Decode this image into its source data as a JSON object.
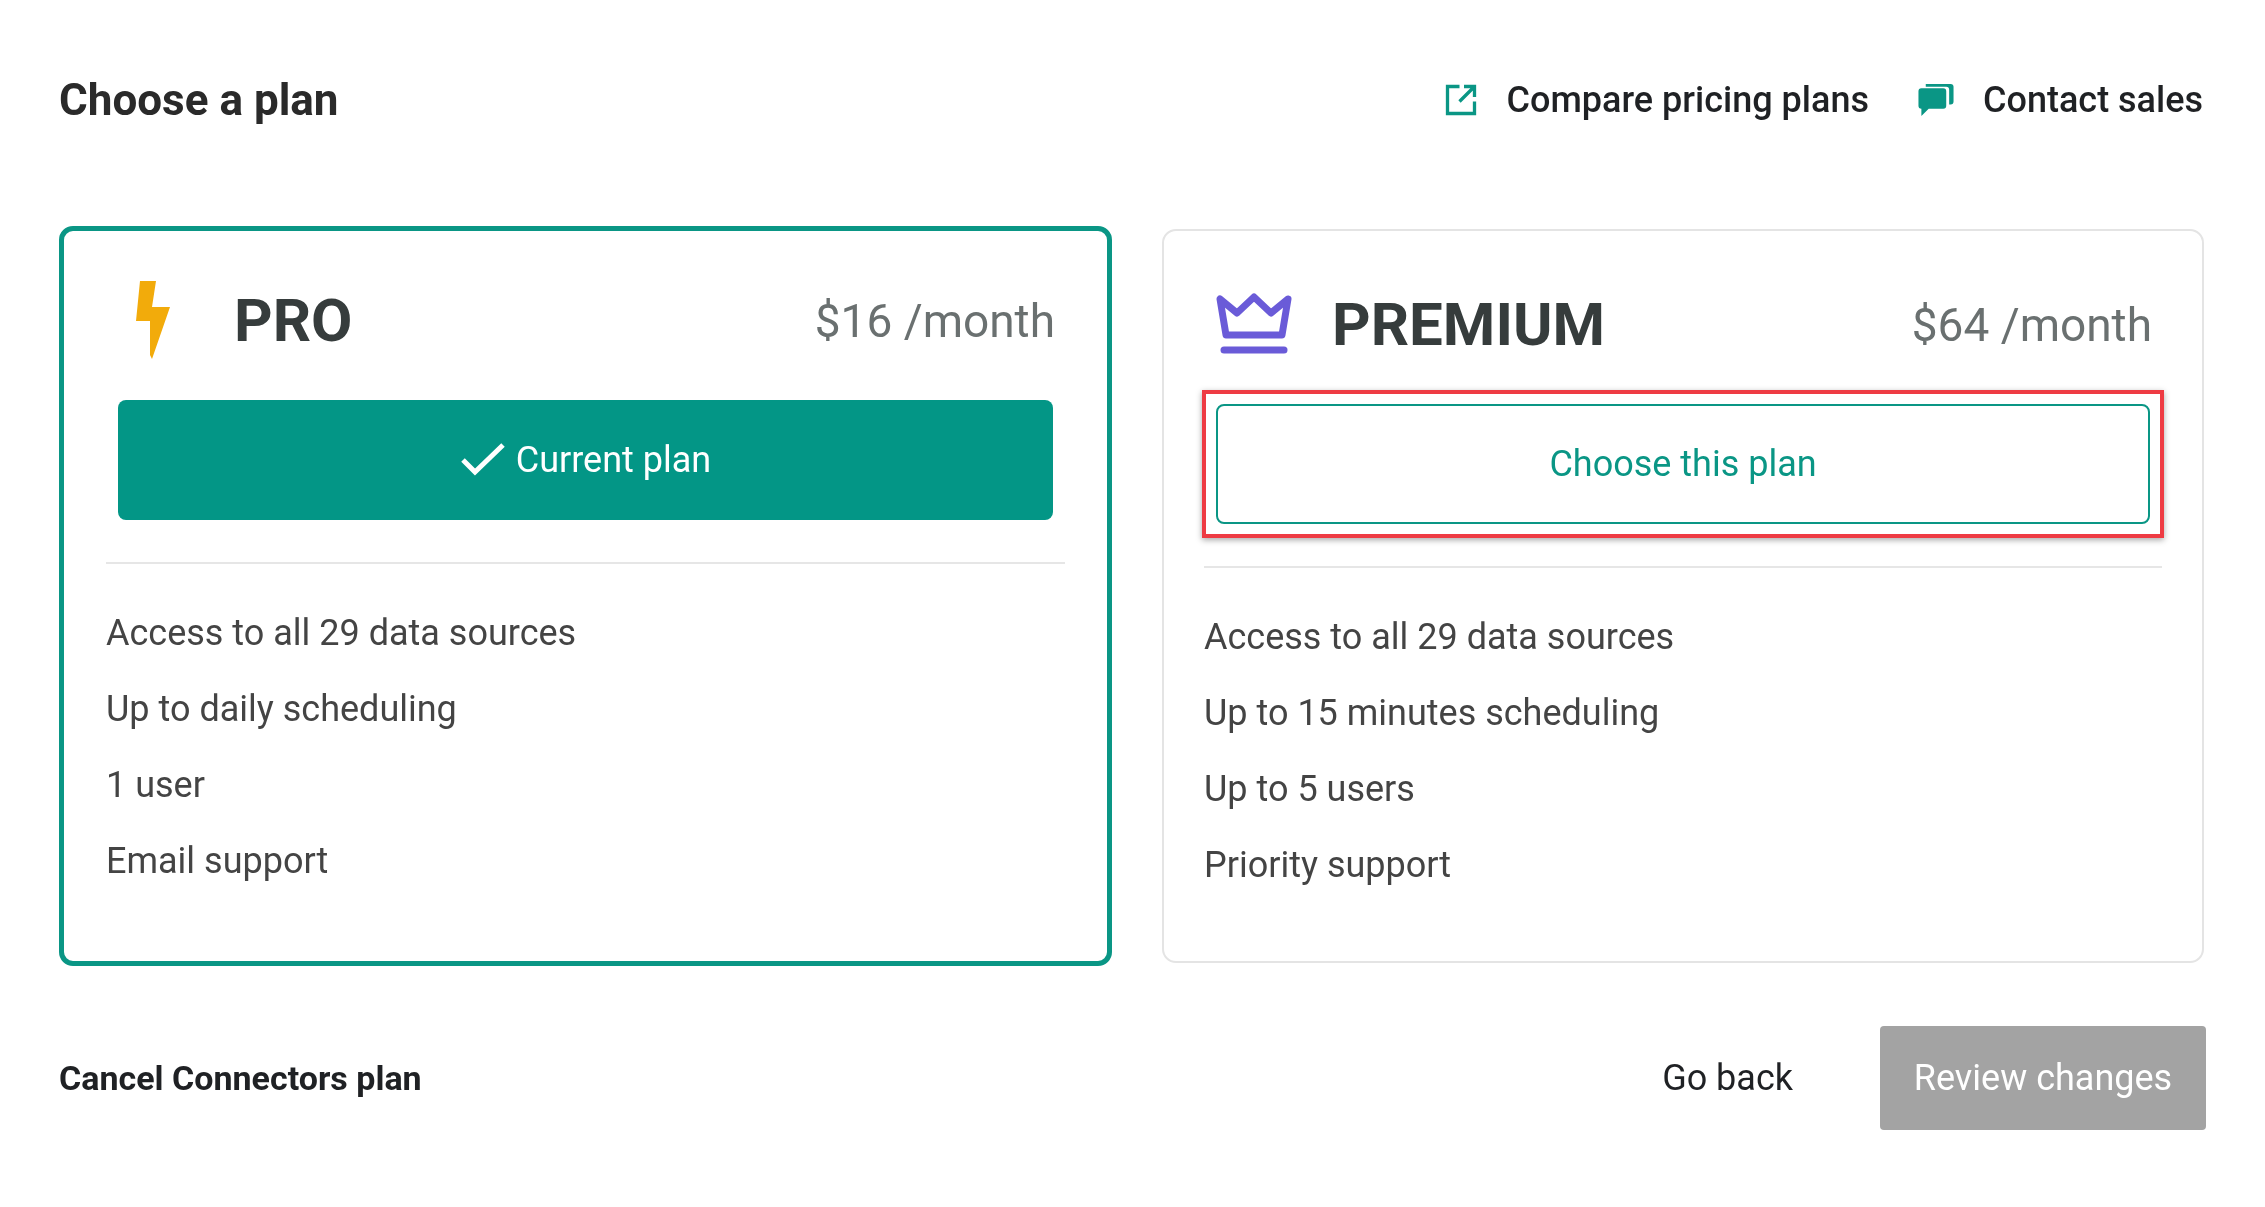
{
  "header": {
    "title": "Choose a plan",
    "links": [
      {
        "kind": "external",
        "label": "Compare pricing plans"
      },
      {
        "kind": "chat",
        "label": "Contact sales"
      }
    ]
  },
  "plans": [
    {
      "kind": "bolt",
      "name": "PRO",
      "price": "$16 /month",
      "current": true,
      "highlighted": false,
      "button": "Current plan",
      "features": [
        "Access to all 29 data sources",
        "Up to daily scheduling",
        "1 user",
        "Email support"
      ]
    },
    {
      "kind": "crown",
      "name": "PREMIUM",
      "price": "$64 /month",
      "current": false,
      "highlighted": true,
      "button": "Choose this plan",
      "features": [
        "Access to all 29 data sources",
        "Up to 15 minutes scheduling",
        "Up to 5 users",
        "Priority support"
      ]
    }
  ],
  "footer": {
    "cancel": "Cancel Connectors plan",
    "back": "Go back",
    "review": {
      "label": "Review changes",
      "disabled": true
    }
  }
}
